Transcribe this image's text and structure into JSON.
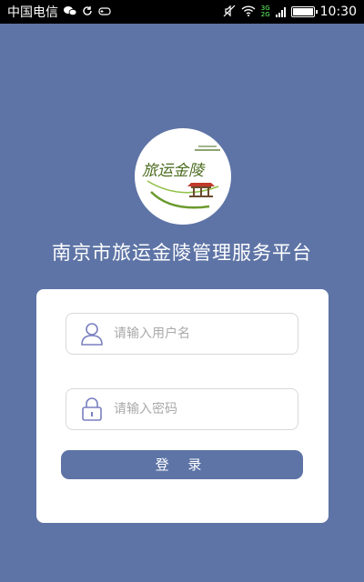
{
  "status_bar": {
    "carrier": "中国电信",
    "time": "10:30",
    "network_top": "3G",
    "network_bottom": "2G",
    "icons": [
      "wechat-icon",
      "sync-icon",
      "gamepad-icon",
      "mute-icon",
      "wifi-icon",
      "signal-icon",
      "battery-icon"
    ]
  },
  "logo": {
    "text": "旅运金陵",
    "colors": {
      "text": "#4a6b1e",
      "accent": "#6b9a2e",
      "roof": "#c0392b"
    }
  },
  "app": {
    "title": "南京市旅运金陵管理服务平台"
  },
  "login": {
    "username_placeholder": "请输入用户名",
    "username_value": "",
    "password_placeholder": "请输入密码",
    "password_value": "",
    "submit_label": "登 录"
  },
  "colors": {
    "background": "#5e74a6",
    "button": "#5e74a6",
    "icon": "#7a7fc0"
  }
}
